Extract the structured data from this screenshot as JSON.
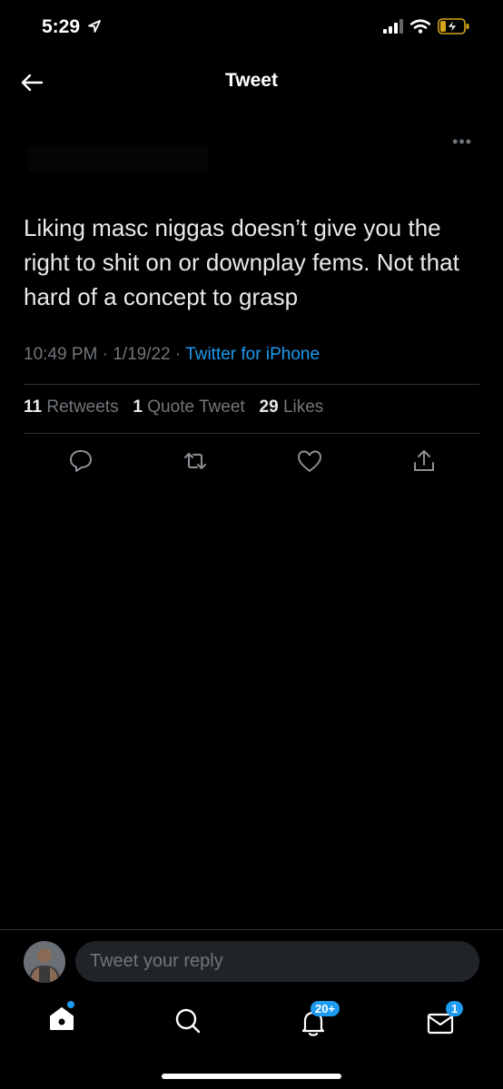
{
  "status_bar": {
    "time": "5:29"
  },
  "header": {
    "title": "Tweet"
  },
  "tweet": {
    "text": "Liking masc niggas doesn’t give you the right to shit on or downplay fems. Not that hard of a concept to grasp",
    "time": "10:49 PM",
    "date": "1/19/22",
    "source": "Twitter for iPhone",
    "retweets_count": "11",
    "retweets_label": "Retweets",
    "quote_count": "1",
    "quote_label": "Quote Tweet",
    "likes_count": "29",
    "likes_label": "Likes"
  },
  "reply": {
    "placeholder": "Tweet your reply"
  },
  "tabbar": {
    "notifications_badge": "20+",
    "messages_badge": "1"
  },
  "colors": {
    "accent": "#1d9bf0",
    "background": "#000000",
    "secondary_text": "#71767b"
  }
}
